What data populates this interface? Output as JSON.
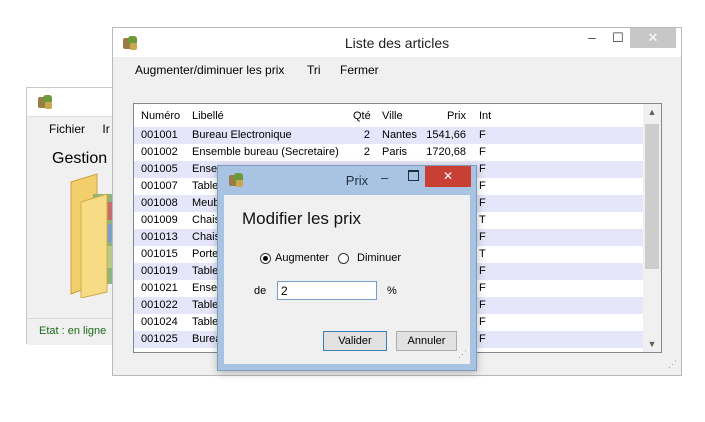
{
  "back_window": {
    "menu": [
      "Fichier",
      "Ir"
    ],
    "title_text": "Gestion",
    "status": "Etat : en ligne"
  },
  "main_window": {
    "title": "Liste des articles",
    "controls": {
      "minimize": "–",
      "maximize": "☐",
      "close": "✕"
    },
    "menu": [
      "Augmenter/diminuer les prix",
      "Tri",
      "Fermer"
    ],
    "table": {
      "columns": [
        "Numéro",
        "Libellé",
        "Qté",
        "Ville",
        "Prix",
        "Int"
      ],
      "rows": [
        [
          "001001",
          "Bureau Electronique",
          "2",
          "Nantes",
          "1541,66",
          "F"
        ],
        [
          "001002",
          "Ensemble bureau (Secretaire)",
          "2",
          "Paris",
          "1720,68",
          "F"
        ],
        [
          "001005",
          "Ense",
          "",
          "",
          "",
          "F"
        ],
        [
          "001007",
          "Table",
          "",
          "",
          "",
          "F"
        ],
        [
          "001008",
          "Meub",
          "",
          "",
          "",
          "F"
        ],
        [
          "001009",
          "Chais",
          "",
          "",
          "",
          "T"
        ],
        [
          "001013",
          "Chais",
          "",
          "",
          "",
          "F"
        ],
        [
          "001015",
          "Porte",
          "",
          "",
          "",
          "T"
        ],
        [
          "001019",
          "Table",
          "",
          "",
          "",
          "F"
        ],
        [
          "001021",
          "Ense",
          "",
          "",
          "",
          "F"
        ],
        [
          "001022",
          "Table",
          "",
          "",
          "",
          "F"
        ],
        [
          "001024",
          "Table",
          "",
          "",
          "",
          "F"
        ],
        [
          "001025",
          "Burea",
          "",
          "",
          "",
          "F"
        ]
      ]
    }
  },
  "dialog": {
    "title": "Prix",
    "controls": {
      "minimize": "–",
      "close": "✕"
    },
    "heading": "Modifier les prix",
    "radio_increase": "Augmenter",
    "radio_decrease": "Diminuer",
    "selected": "Augmenter",
    "amount_label": "de",
    "amount_value": "2",
    "unit": "%",
    "ok_button": "Valider",
    "cancel_button": "Annuler"
  },
  "colors": {
    "row_alt": "#e6e6fa",
    "dialog_frame": "#a9c4e2",
    "dialog_close": "#c84033",
    "status_text": "#1b6b1b"
  }
}
